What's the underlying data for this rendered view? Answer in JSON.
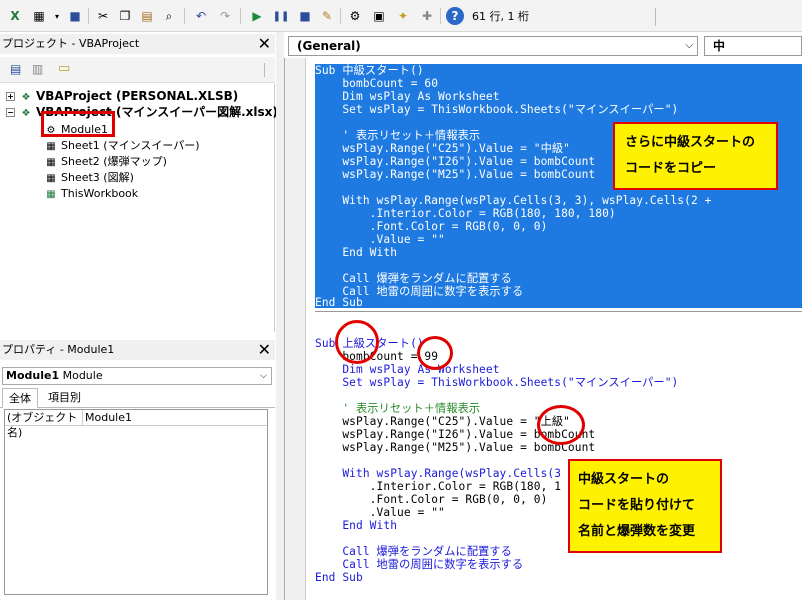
{
  "toolbar": {
    "cursor_position": "61 行, 1 桁",
    "icons": [
      "excel-icon",
      "insert-userform-icon",
      "save-icon",
      "cut-icon",
      "copy-icon",
      "paste-icon",
      "find-icon",
      "undo-icon",
      "redo-icon",
      "run-icon",
      "break-icon",
      "reset-icon",
      "design-mode-icon",
      "project-explorer-icon",
      "properties-icon",
      "object-browser-icon",
      "toolbox-icon",
      "help-icon"
    ]
  },
  "project": {
    "title": "プロジェクト - VBAProject",
    "nodes": [
      {
        "label": "VBAProject (PERSONAL.XLSB)"
      },
      {
        "label": "VBAProject (マインスイーパー図解.xlsx)"
      },
      {
        "label": "Module1"
      },
      {
        "label": "Sheet1 (マインスイーパー)"
      },
      {
        "label": "Sheet2 (爆弾マップ)"
      },
      {
        "label": "Sheet3 (図解)"
      },
      {
        "label": "ThisWorkbook"
      }
    ]
  },
  "properties": {
    "title": "プロパティ - Module1",
    "object_name": "Module1",
    "object_type": "Module",
    "tabs": [
      "全体",
      "項目別"
    ],
    "rows": [
      {
        "name": "(オブジェクト名)",
        "value": "Module1"
      }
    ]
  },
  "code": {
    "object_combo": "(General)",
    "proc_combo": "中",
    "block1": [
      "Sub 中級スタート()",
      "    bombCount = 60",
      "    Dim wsPlay As Worksheet",
      "    Set wsPlay = ThisWorkbook.Sheets(\"マインスイーパー\")",
      "",
      "    ' 表示リセット＋情報表示",
      "    wsPlay.Range(\"C25\").Value = \"中級\"",
      "    wsPlay.Range(\"I26\").Value = bombCount",
      "    wsPlay.Range(\"M25\").Value = bombCount",
      "",
      "    With wsPlay.Range(wsPlay.Cells(3, 3), wsPlay.Cells(2 +",
      "        .Interior.Color = RGB(180, 180, 180)",
      "        .Font.Color = RGB(0, 0, 0)",
      "        .Value = \"\"",
      "    End With",
      "",
      "    Call 爆弾をランダムに配置する",
      "    Call 地雷の周囲に数字を表示する",
      "End Sub"
    ],
    "block2": [
      "Sub 上級スタート()",
      "    bombCount = 99",
      "    Dim wsPlay As Worksheet",
      "    Set wsPlay = ThisWorkbook.Sheets(\"マインスイーパー\")",
      "",
      "    ' 表示リセット＋情報表示",
      "    wsPlay.Range(\"C25\").Value = \"上級\"",
      "    wsPlay.Range(\"I26\").Value = bombCount",
      "    wsPlay.Range(\"M25\").Value = bombCount",
      "",
      "    With wsPlay.Range(wsPlay.Cells(3",
      "        .Interior.Color = RGB(180, 1",
      "        .Font.Color = RGB(0, 0, 0)",
      "        .Value = \"\"",
      "    End With",
      "",
      "    Call 爆弾をランダムに配置する",
      "    Call 地雷の周囲に数字を表示する",
      "End Sub"
    ]
  },
  "annotations": {
    "copy_note": [
      "さらに中級スタートの",
      "コードをコピー"
    ],
    "paste_note": [
      "中級スタートの",
      "コードを貼り付けて",
      "名前と爆弾数を変更"
    ]
  },
  "colors": {
    "selection": "#1e7ae0",
    "annotation_fill": "#fff200",
    "annotation_border": "#e00000",
    "keyword": "#1a1adb",
    "comment": "#2a8a2a"
  }
}
